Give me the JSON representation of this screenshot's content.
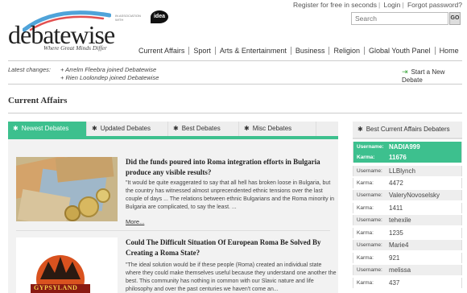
{
  "header": {
    "top_links": {
      "register": "Register for free in seconds",
      "login": "Login",
      "forgot": "Forgot password?"
    },
    "search": {
      "placeholder": "Search",
      "go_label": "GO"
    },
    "logo": {
      "word": "debatewise",
      "tagline": "Where Great Minds Differ",
      "association": "IN ASSOCIATION WITH",
      "partner": "idea"
    }
  },
  "nav": {
    "items": [
      "Current Affairs",
      "Sport",
      "Arts & Entertainment",
      "Business",
      "Religion",
      "Global Youth Panel",
      "Home"
    ]
  },
  "latest_changes": {
    "label": "Latest changes:",
    "items": [
      "+ Arrelm Fleebra joined Debatewise",
      "+ Rien Loolondep joined Debatewise"
    ],
    "new_debate": "Start a New Debate"
  },
  "section_title": "Current Affairs",
  "tabs": [
    "Newest Debates",
    "Updated Debates",
    "Best Debates",
    "Misc Debates"
  ],
  "debates": [
    {
      "title": "Did the funds poured into Roma integration efforts in Bulgaria produce any visible results?",
      "excerpt": "\"It would be quite exaggerated to say that all hell has broken loose in Bulgaria, but the country has witnessed almost unprecendented ethnic tensions over the last couple of days ... The relations between ethnic Bulgarians and the Roma minority in Bulgaria are complicated, to say the least. ...",
      "more": "More..."
    },
    {
      "title": "Could The Difficult Situation Of European Roma Be Solved By Creating a Roma State?",
      "excerpt": "\"The ideal solution would be if these people (Roma) created an individual state where they could make themselves useful because they understand one another the best. This community has nothing in common with our Slavic nature and life philosophy and over the past centuries we haven't come an...",
      "poster_text": "GYPSYLAND"
    }
  ],
  "best_debaters": {
    "title": "Best Current Affairs Debaters",
    "username_label": "Username:",
    "karma_label": "Karma:",
    "users": [
      {
        "username": "NADIA999",
        "karma": "11676"
      },
      {
        "username": "LLBlynch",
        "karma": "4472"
      },
      {
        "username": "ValeryNovoselsky",
        "karma": "1411"
      },
      {
        "username": "tehexile",
        "karma": "1235"
      },
      {
        "username": "Marie4",
        "karma": "921"
      },
      {
        "username": "melissa",
        "karma": "437"
      }
    ]
  },
  "colors": {
    "accent": "#3dc08e"
  }
}
